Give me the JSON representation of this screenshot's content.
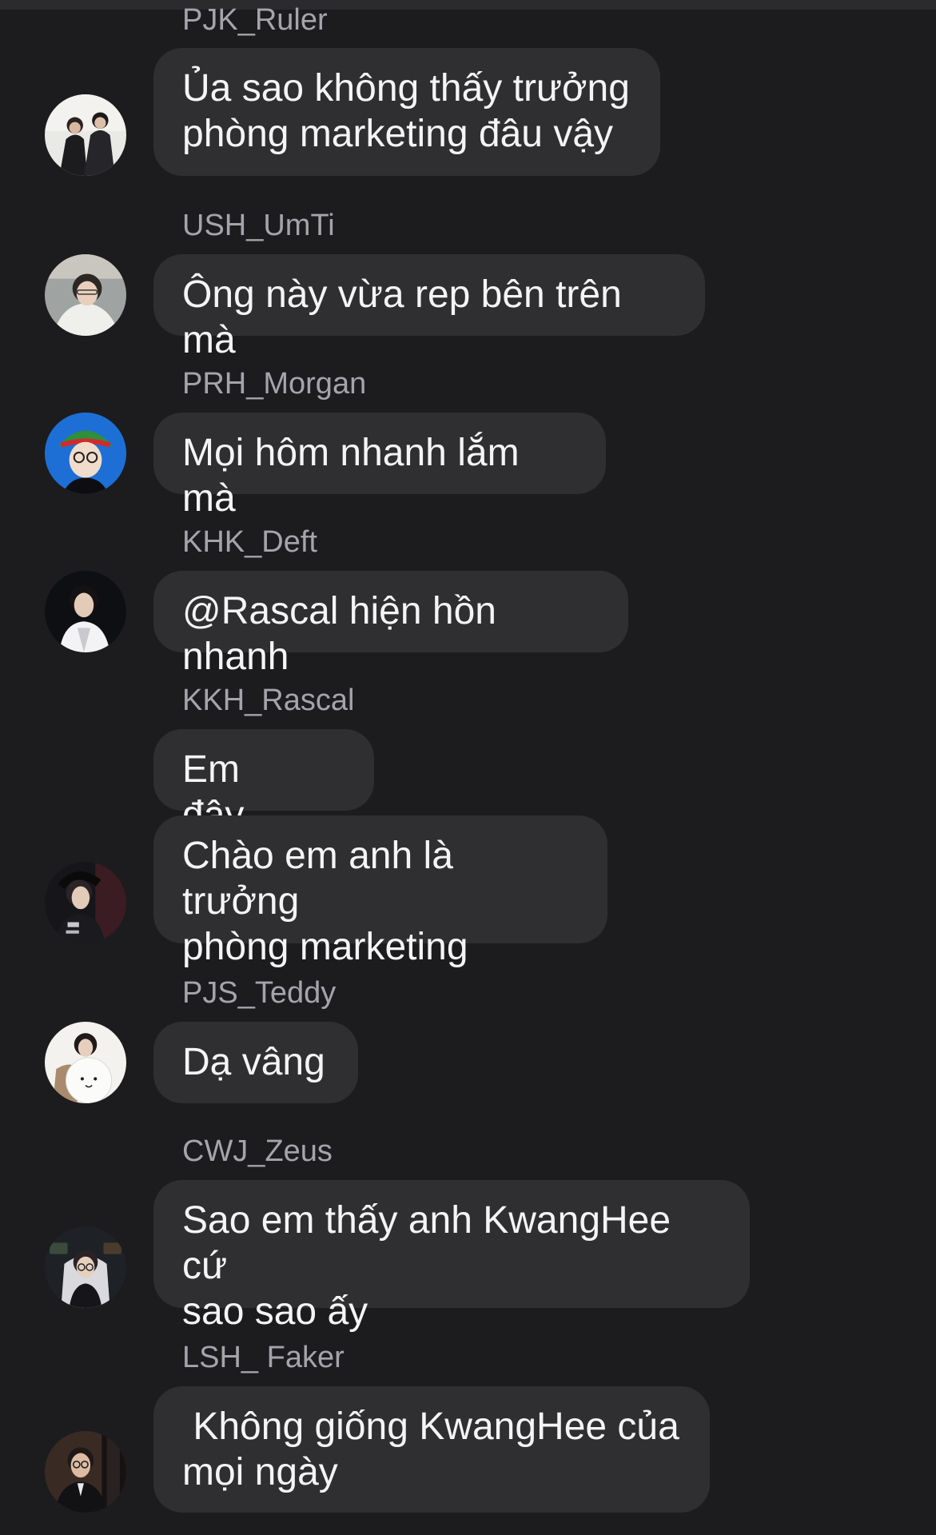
{
  "messages": [
    {
      "sender": "PJK_Ruler",
      "text": "Ủa sao không thấy trưởng\nphòng marketing đâu vậy",
      "avatar": "avatar-photo-ruler"
    },
    {
      "sender": "USH_UmTi",
      "text": "Ông này vừa rep bên trên mà",
      "avatar": "avatar-photo-umti"
    },
    {
      "sender": "PRH_Morgan",
      "text": "Mọi hôm nhanh lắm mà",
      "avatar": "avatar-photo-morgan"
    },
    {
      "sender": "KHK_Deft",
      "text": "@Rascal hiện hồn nhanh",
      "avatar": "avatar-photo-deft"
    },
    {
      "sender": "KKH_Rascal",
      "text": "Em đây....",
      "text2": "Chào em anh là trưởng\nphòng marketing",
      "avatar": "avatar-photo-rascal"
    },
    {
      "sender": "PJS_Teddy",
      "text": "Dạ vâng",
      "avatar": "avatar-photo-teddy"
    },
    {
      "sender": "CWJ_Zeus",
      "text": "Sao em thấy anh KwangHee cứ\nsao sao ấy",
      "avatar": "avatar-photo-zeus"
    },
    {
      "sender": "LSH_ Faker",
      "text": " Không giống KwangHee của\nmọi ngày",
      "avatar": "avatar-photo-faker"
    }
  ],
  "colors": {
    "background": "#1c1c1e",
    "bubble": "#2f2f31",
    "message_text": "#f4f4f6",
    "sender_text": "#a4a4aa"
  }
}
